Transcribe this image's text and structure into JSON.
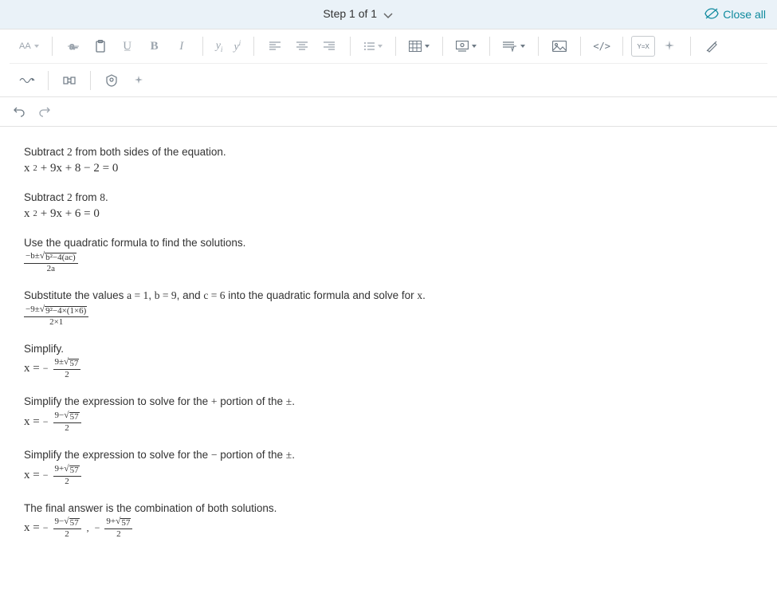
{
  "header": {
    "step_label": "Step 1 of 1",
    "close_all": "Close all"
  },
  "toolbar": {
    "font_size": "AA",
    "yi_label": "y",
    "yi_sub": "i",
    "yi2_label": "y",
    "yi2_sup": "i",
    "code_label": "</>",
    "yx_label": "Y=X"
  },
  "steps": [
    {
      "desc_pre": "Subtract ",
      "desc_m1": "2",
      "desc_post": " from both sides of the equation.",
      "eq_html": "x<span class='sup'>2</span> + 9x + 8 − 2 = 0"
    },
    {
      "desc_pre": "Subtract ",
      "desc_m1": "2",
      "desc_mid": " from ",
      "desc_m2": "8",
      "desc_post": ".",
      "eq_html": "x<span class='sup'>2</span> + 9x + 6 = 0"
    },
    {
      "desc_full": "Use the quadratic formula to find the solutions.",
      "frac_num": "−b±<span class='sqrt'><span class='rad'>√</span><span class='vinculum'>b²−4(ac)</span></span>",
      "frac_den": "2a"
    },
    {
      "desc_pre": "Substitute the values ",
      "desc_a": "a = 1",
      "desc_sep1": ", ",
      "desc_b": "b = 9",
      "desc_sep2": ", and ",
      "desc_c": "c = 6",
      "desc_post": " into the quadratic formula and solve for ",
      "desc_x": "x",
      "desc_end": ".",
      "frac_num": "−9±<span class='sqrt'><span class='rad'>√</span><span class='vinculum'>9²−4×(1×6)</span></span>",
      "frac_den": "2×1"
    },
    {
      "desc_full": "Simplify.",
      "prefix": "x = ",
      "neg": "−",
      "frac_num": "9±<span class='sqrt'><span class='rad'>√</span><span class='vinculum'>57</span></span>",
      "frac_den": "2"
    },
    {
      "desc_pre": "Simplify the expression to solve for the ",
      "desc_m1": "+",
      "desc_mid": " portion of the ",
      "desc_m2": "±",
      "desc_post": ".",
      "prefix": "x = ",
      "neg": "−",
      "frac_num": "9−<span class='sqrt'><span class='rad'>√</span><span class='vinculum'>57</span></span>",
      "frac_den": "2"
    },
    {
      "desc_pre": "Simplify the expression to solve for the ",
      "desc_m1": "−",
      "desc_mid": " portion of the ",
      "desc_m2": "±",
      "desc_post": ".",
      "prefix": "x = ",
      "neg": "−",
      "frac_num": "9+<span class='sqrt'><span class='rad'>√</span><span class='vinculum'>57</span></span>",
      "frac_den": "2"
    },
    {
      "desc_full": "The final answer is the combination of both solutions.",
      "prefix": "x = ",
      "neg": "−",
      "frac_num": "9−<span class='sqrt'><span class='rad'>√</span><span class='vinculum'>57</span></span>",
      "frac_den": "2",
      "comma": ",",
      "neg2": "−",
      "frac2_num": "9+<span class='sqrt'><span class='rad'>√</span><span class='vinculum'>57</span></span>",
      "frac2_den": "2"
    }
  ]
}
